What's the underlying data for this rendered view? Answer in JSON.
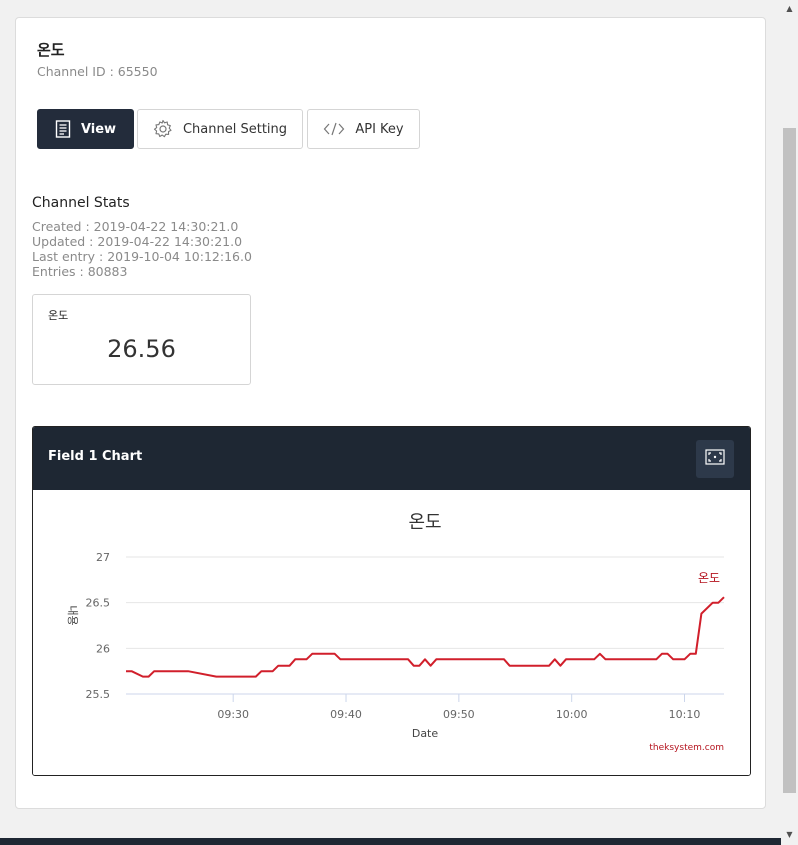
{
  "channel": {
    "title": "온도",
    "id_text": "Channel ID : 65550"
  },
  "tabs": {
    "view": "View",
    "setting": "Channel Setting",
    "api": "API Key"
  },
  "stats": {
    "title": "Channel Stats",
    "created": "Created : 2019-04-22 14:30:21.0",
    "updated": "Updated : 2019-04-22 14:30:21.0",
    "last_entry": "Last entry : 2019-10-04 10:12:16.0",
    "entries": "Entries : 80883"
  },
  "widget": {
    "label": "온도",
    "value": "26.56"
  },
  "chart_panel": {
    "title": "Field 1 Chart"
  },
  "colors": {
    "header_dark": "#1e2733",
    "line": "#d11f2b"
  },
  "chart_data": {
    "type": "line",
    "title": "온도",
    "xlabel": "Date",
    "ylabel": "내용",
    "credit": "theksystem.com",
    "series_label": "온도",
    "xlim": [
      "09:20:30",
      "10:13:30"
    ],
    "ylim": [
      25.5,
      27.0
    ],
    "x_ticks": [
      "09:30",
      "09:40",
      "09:50",
      "10:00",
      "10:10"
    ],
    "y_ticks": [
      25.5,
      26,
      26.5,
      27
    ],
    "grid": true,
    "series": [
      {
        "points": [
          [
            "09:20:30",
            25.75
          ],
          [
            "09:21:00",
            25.75
          ],
          [
            "09:22:00",
            25.69
          ],
          [
            "09:22:30",
            25.69
          ],
          [
            "09:23:00",
            25.75
          ],
          [
            "09:26:00",
            25.75
          ],
          [
            "09:28:30",
            25.69
          ],
          [
            "09:32:00",
            25.69
          ],
          [
            "09:32:30",
            25.75
          ],
          [
            "09:33:30",
            25.75
          ],
          [
            "09:34:00",
            25.81
          ],
          [
            "09:35:00",
            25.81
          ],
          [
            "09:35:30",
            25.88
          ],
          [
            "09:36:30",
            25.88
          ],
          [
            "09:37:00",
            25.94
          ],
          [
            "09:39:00",
            25.94
          ],
          [
            "09:39:30",
            25.88
          ],
          [
            "09:45:30",
            25.88
          ],
          [
            "09:46:00",
            25.81
          ],
          [
            "09:46:30",
            25.81
          ],
          [
            "09:47:00",
            25.88
          ],
          [
            "09:47:30",
            25.81
          ],
          [
            "09:48:00",
            25.88
          ],
          [
            "09:54:00",
            25.88
          ],
          [
            "09:54:30",
            25.81
          ],
          [
            "09:58:00",
            25.81
          ],
          [
            "09:58:30",
            25.88
          ],
          [
            "09:59:00",
            25.81
          ],
          [
            "09:59:30",
            25.88
          ],
          [
            "10:02:00",
            25.88
          ],
          [
            "10:02:30",
            25.94
          ],
          [
            "10:03:00",
            25.88
          ],
          [
            "10:07:30",
            25.88
          ],
          [
            "10:08:00",
            25.94
          ],
          [
            "10:08:30",
            25.94
          ],
          [
            "10:09:00",
            25.88
          ],
          [
            "10:10:00",
            25.88
          ],
          [
            "10:10:30",
            25.94
          ],
          [
            "10:11:00",
            25.94
          ],
          [
            "10:11:30",
            26.38
          ],
          [
            "10:12:30",
            26.5
          ],
          [
            "10:13:00",
            26.5
          ],
          [
            "10:13:30",
            26.56
          ]
        ]
      }
    ]
  }
}
